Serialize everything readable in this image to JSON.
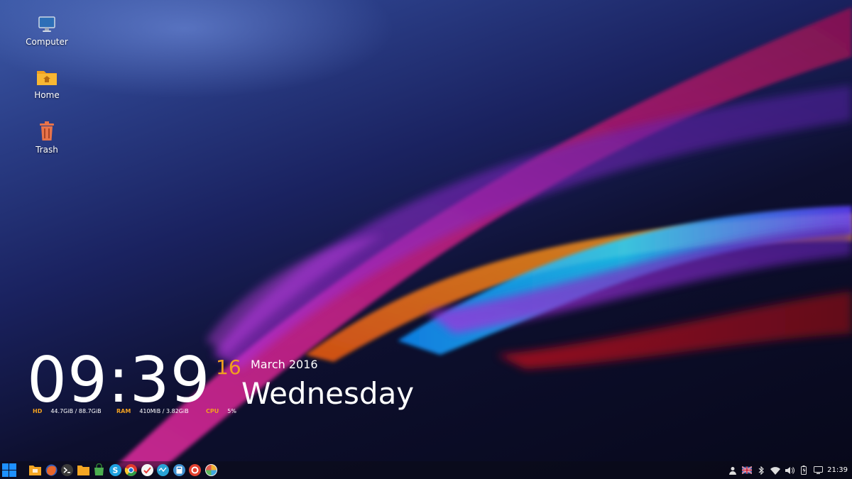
{
  "desktop": {
    "icons": [
      {
        "label": "Computer",
        "icon": "computer-icon"
      },
      {
        "label": "Home",
        "icon": "home-folder-icon"
      },
      {
        "label": "Trash",
        "icon": "trash-icon"
      }
    ]
  },
  "clock_widget": {
    "time": "09:39",
    "day": "16",
    "month_year": "March 2016",
    "weekday": "Wednesday",
    "stats": {
      "hd": {
        "label": "HD",
        "value": "44.7GiB / 88.7GiB"
      },
      "ram": {
        "label": "RAM",
        "value": "410MiB  / 3.82GiB"
      },
      "cpu": {
        "label": "CPU",
        "value": "5%"
      }
    }
  },
  "taskbar": {
    "start_icon": "windows-logo-icon",
    "launchers": [
      {
        "icon": "desktop-folder-icon",
        "color": "#f4a623"
      },
      {
        "icon": "firefox-icon",
        "color": "#e8662b"
      },
      {
        "icon": "terminal-icon",
        "color": "#3a3a3a"
      },
      {
        "icon": "file-manager-icon",
        "color": "#f4a623"
      },
      {
        "icon": "store-bag-icon",
        "color": "#4caf50"
      },
      {
        "icon": "skype-icon",
        "color": "#1ea1e0"
      },
      {
        "icon": "chrome-icon",
        "color": "#e0382e"
      },
      {
        "icon": "task-manager-icon",
        "color": "#e53935"
      },
      {
        "icon": "monitor-icon",
        "color": "#29a3d6"
      },
      {
        "icon": "calculator-icon",
        "color": "#3f8fd0"
      },
      {
        "icon": "screen-recorder-icon",
        "color": "#e04030"
      },
      {
        "icon": "pinwheel-icon",
        "color": "#f2b233"
      }
    ],
    "tray": {
      "icons": [
        "user-icon",
        "uk-flag-icon",
        "bluetooth-icon",
        "wifi-icon",
        "volume-icon",
        "battery-icon",
        "display-icon"
      ],
      "clock": "21:39"
    }
  },
  "colors": {
    "accent": "#f0a020",
    "text": "#ffffff"
  }
}
